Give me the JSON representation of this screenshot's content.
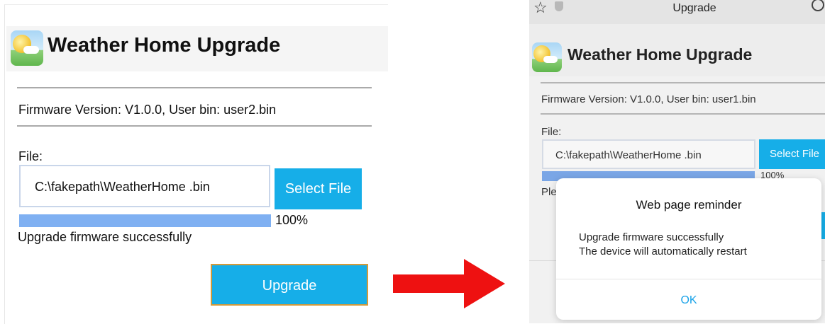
{
  "left": {
    "title": "Weather Home Upgrade",
    "firmware_info": "Firmware Version: V1.0.0, User bin: user2.bin",
    "file_label": "File:",
    "file_value": "C:\\fakepath\\WeatherHome .bin",
    "select_label": "Select File",
    "progress_percent": "100%",
    "progress_value": 1.0,
    "status_message": "Upgrade firmware successfully",
    "upgrade_label": "Upgrade"
  },
  "arrow": {
    "color": "#ee1111",
    "icon": "arrow-right-icon"
  },
  "right": {
    "toolbar_title": "Upgrade",
    "title": "Weather Home Upgrade",
    "firmware_info": "Firmware Version: V1.0.0, User bin: user1.bin",
    "file_label": "File:",
    "file_value": "C:\\fakepath\\WeatherHome .bin",
    "select_label": "Select File",
    "progress_percent": "100%",
    "progress_value": 1.0,
    "partial_text": "Ple",
    "dialog": {
      "title": "Web page reminder",
      "line1": "Upgrade firmware successfully",
      "line2": "The device will automatically restart",
      "ok_label": "OK"
    }
  },
  "colors": {
    "accent": "#16aee8",
    "progress": "#7fb0f2",
    "ok_text": "#1aa3e8"
  }
}
